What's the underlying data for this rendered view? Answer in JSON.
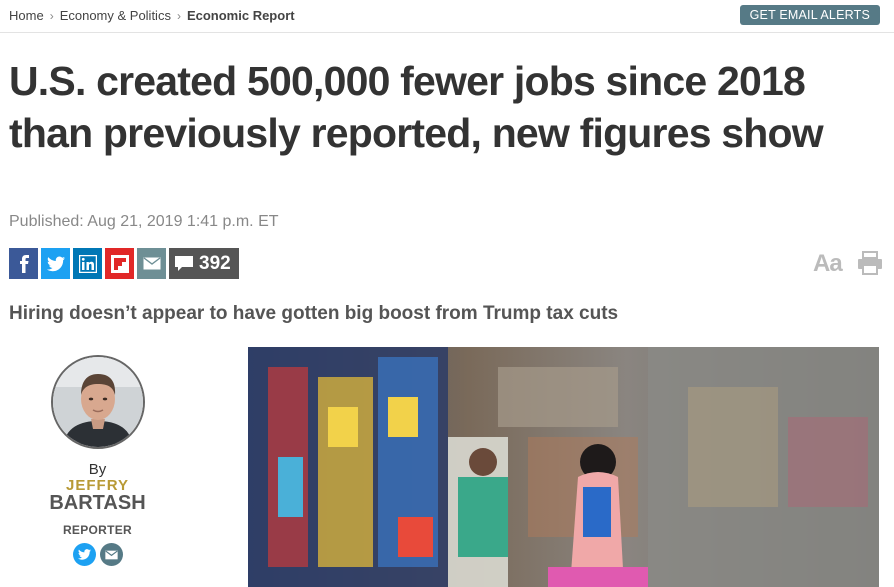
{
  "breadcrumb": {
    "items": [
      "Home",
      "Economy & Politics",
      "Economic Report"
    ]
  },
  "email_alerts_label": "GET EMAIL ALERTS",
  "article": {
    "headline": "U.S. created 500,000 fewer jobs since 2018 than previously reported, new figures show",
    "published": "Published: Aug 21, 2019 1:41 p.m. ET",
    "dek": "Hiring doesn’t appear to have gotten big boost from Trump tax cuts"
  },
  "share": {
    "comment_count": "392",
    "icons": [
      "facebook-icon",
      "twitter-icon",
      "linkedin-icon",
      "flipboard-icon",
      "email-icon",
      "comment-icon"
    ]
  },
  "tools": {
    "font_size_label": "Aa",
    "print_icon": "print-icon"
  },
  "author": {
    "by": "By",
    "first_name": "JEFFRY",
    "last_name": "BARTASH",
    "role": "REPORTER"
  },
  "colors": {
    "email_button": "#567a86",
    "facebook": "#3b5998",
    "twitter": "#1da1f2",
    "linkedin": "#0077b5",
    "flipboard": "#e12828",
    "author_first_name": "#b89a36"
  }
}
